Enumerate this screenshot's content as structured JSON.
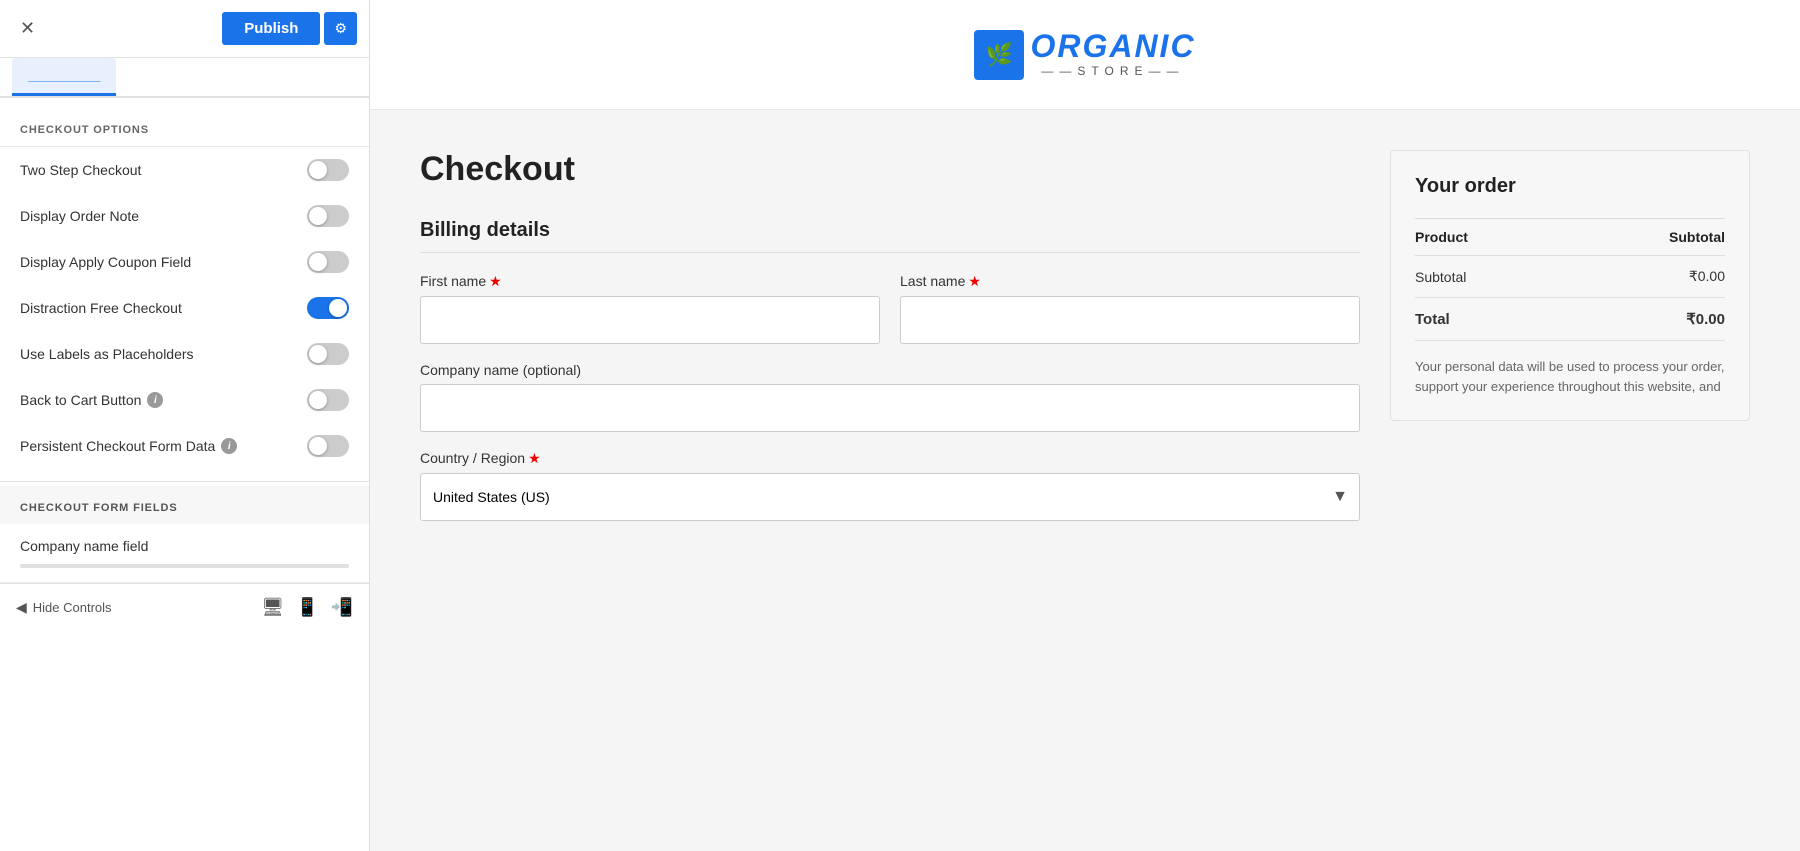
{
  "topBar": {
    "closeLabel": "✕",
    "publishLabel": "Publish",
    "gearLabel": "⚙"
  },
  "tab": {
    "activeLabel": "___________"
  },
  "checkoutOptions": {
    "sectionTitle": "CHECKOUT OPTIONS",
    "options": [
      {
        "id": "two-step-checkout",
        "label": "Two Step Checkout",
        "on": false,
        "hasHelp": false
      },
      {
        "id": "display-order-note",
        "label": "Display Order Note",
        "on": false,
        "hasHelp": false
      },
      {
        "id": "display-apply-coupon",
        "label": "Display Apply Coupon Field",
        "on": false,
        "hasHelp": false
      },
      {
        "id": "distraction-free",
        "label": "Distraction Free Checkout",
        "on": true,
        "hasHelp": false
      },
      {
        "id": "use-labels",
        "label": "Use Labels as Placeholders",
        "on": false,
        "hasHelp": false
      },
      {
        "id": "back-to-cart",
        "label": "Back to Cart Button",
        "on": false,
        "hasHelp": true
      },
      {
        "id": "persistent-checkout",
        "label": "Persistent Checkout Form Data",
        "on": false,
        "hasHelp": true
      }
    ]
  },
  "checkoutFormFields": {
    "sectionTitle": "CHECKOUT FORM FIELDS",
    "fieldLabel": "Company name field"
  },
  "bottomBar": {
    "hideControlsLabel": "Hide Controls"
  },
  "siteHeader": {
    "logoText": "RGANIC",
    "logoHighlight": "O",
    "logoSub": "STORE"
  },
  "checkout": {
    "pageTitle": "Checkout",
    "billingTitle": "Billing details",
    "fields": {
      "firstNameLabel": "First name",
      "lastNameLabel": "Last name",
      "companyLabel": "Company name (optional)",
      "countryLabel": "Country / Region",
      "countryValue": "United States (US)"
    }
  },
  "orderPanel": {
    "title": "Your order",
    "productHeader": "Product",
    "subtotalHeader": "Subtotal",
    "subtotalLabel": "Subtotal",
    "subtotalValue": "₹0.00",
    "totalLabel": "Total",
    "totalValue": "₹0.00",
    "privacyNote": "Your personal data will be used to process your order, support your experience throughout this website, and"
  }
}
